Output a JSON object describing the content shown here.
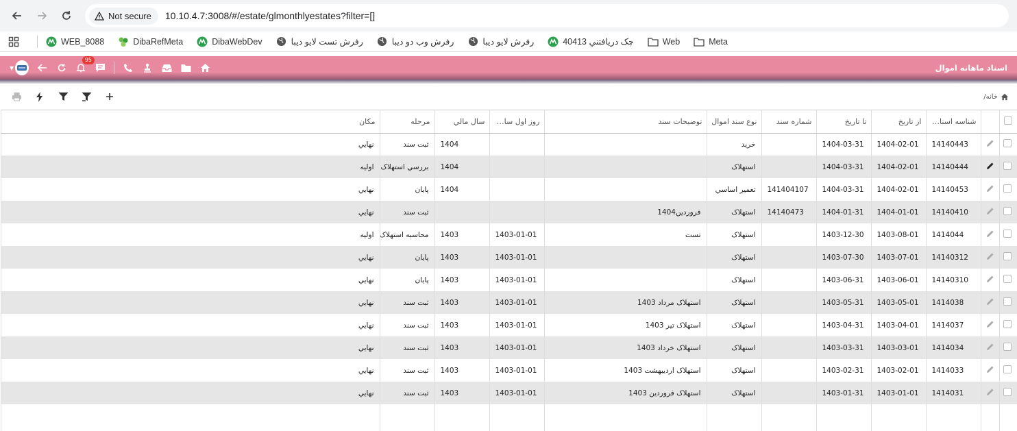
{
  "browser": {
    "security_label": "Not secure",
    "url": "10.10.4.7:3008/#/estate/glmonthlyestates?filter=[]"
  },
  "bookmarks": [
    {
      "label": "WEB_8088",
      "icon": "diba-icon"
    },
    {
      "label": "DibaRefMeta",
      "icon": "meta-icon"
    },
    {
      "label": "DibaWebDev",
      "icon": "diba-icon"
    },
    {
      "label": "رفرش تست لایو دیبا",
      "icon": "globe-icon"
    },
    {
      "label": "رفرش وب دو دیبا",
      "icon": "globe-icon"
    },
    {
      "label": "رفرش لایو دیبا",
      "icon": "globe-icon"
    },
    {
      "label": "چک دریافتني 40413",
      "icon": "diba-icon"
    },
    {
      "label": "Web",
      "icon": "folder-icon"
    },
    {
      "label": "Meta",
      "icon": "folder-icon"
    }
  ],
  "app": {
    "title": "اسناد ماهانه اموال",
    "notification_count": "95",
    "header_color": "#e8899f"
  },
  "breadcrumb": {
    "home": "خانه/"
  },
  "table": {
    "columns": [
      "شناسه اسناد ...",
      "از تاریخ",
      "تا تاریخ",
      "شماره سند",
      "نوع سند اموال",
      "توضیحات سند",
      "روز اول سال ...",
      "سال مالي",
      "مرحله",
      "مکان"
    ],
    "rows": [
      {
        "id": "14140443",
        "from": "1404-02-01",
        "to": "1404-03-31",
        "doc_no": "",
        "type": "خرید",
        "desc": "",
        "first_day": "",
        "year": "1404",
        "stage": "ثبت سند",
        "place": "نهايي"
      },
      {
        "id": "14140444",
        "from": "1404-02-01",
        "to": "1404-03-31",
        "doc_no": "",
        "type": "استهلاک",
        "desc": "",
        "first_day": "",
        "year": "1404",
        "stage": "بررسي استهلاک",
        "place": "اولیه"
      },
      {
        "id": "14140453",
        "from": "1404-02-01",
        "to": "1404-03-31",
        "doc_no": "141404107",
        "type": "تعمیر اساسي",
        "desc": "",
        "first_day": "",
        "year": "1404",
        "stage": "پايان",
        "place": "نهايي"
      },
      {
        "id": "14140410",
        "from": "1404-01-01",
        "to": "1404-01-31",
        "doc_no": "14140473",
        "type": "استهلاک",
        "desc": "فروردين1404",
        "first_day": "",
        "year": "",
        "stage": "ثبت سند",
        "place": "نهايي"
      },
      {
        "id": "1414044",
        "from": "1403-08-01",
        "to": "1403-12-30",
        "doc_no": "",
        "type": "استهلاک",
        "desc": "تست",
        "first_day": "1403-01-01",
        "year": "1403",
        "stage": "محاسبه استهلاک",
        "place": "اولیه"
      },
      {
        "id": "14140312",
        "from": "1403-07-01",
        "to": "1403-07-30",
        "doc_no": "",
        "type": "استهلاک",
        "desc": "",
        "first_day": "1403-01-01",
        "year": "1403",
        "stage": "پايان",
        "place": "نهايي"
      },
      {
        "id": "14140310",
        "from": "1403-06-01",
        "to": "1403-06-31",
        "doc_no": "",
        "type": "استهلاک",
        "desc": "",
        "first_day": "1403-01-01",
        "year": "1403",
        "stage": "پايان",
        "place": "نهايي"
      },
      {
        "id": "1414038",
        "from": "1403-05-01",
        "to": "1403-05-31",
        "doc_no": "",
        "type": "استهلاک",
        "desc": "استهلاک مرداد 1403",
        "first_day": "1403-01-01",
        "year": "1403",
        "stage": "ثبت سند",
        "place": "نهايي"
      },
      {
        "id": "1414037",
        "from": "1403-04-01",
        "to": "1403-04-31",
        "doc_no": "",
        "type": "استهلاک",
        "desc": "استهلاک تیر 1403",
        "first_day": "1403-01-01",
        "year": "1403",
        "stage": "ثبت سند",
        "place": "نهايي"
      },
      {
        "id": "1414034",
        "from": "1403-03-01",
        "to": "1403-03-31",
        "doc_no": "",
        "type": "استهلاک",
        "desc": "استهلاک خرداد 1403",
        "first_day": "1403-01-01",
        "year": "1403",
        "stage": "ثبت سند",
        "place": "نهايي"
      },
      {
        "id": "1414033",
        "from": "1403-02-01",
        "to": "1403-02-31",
        "doc_no": "",
        "type": "استهلاک",
        "desc": "استهلاک اردیبهشت 1403",
        "first_day": "1403-01-01",
        "year": "1403",
        "stage": "ثبت سند",
        "place": "نهايي"
      },
      {
        "id": "1414031",
        "from": "1403-01-01",
        "to": "1403-01-31",
        "doc_no": "",
        "type": "استهلاک",
        "desc": "استهلاک فروردین 1403",
        "first_day": "1403-01-01",
        "year": "1403",
        "stage": "ثبت سند",
        "place": "نهايي"
      }
    ],
    "active_edit_row": 1
  }
}
